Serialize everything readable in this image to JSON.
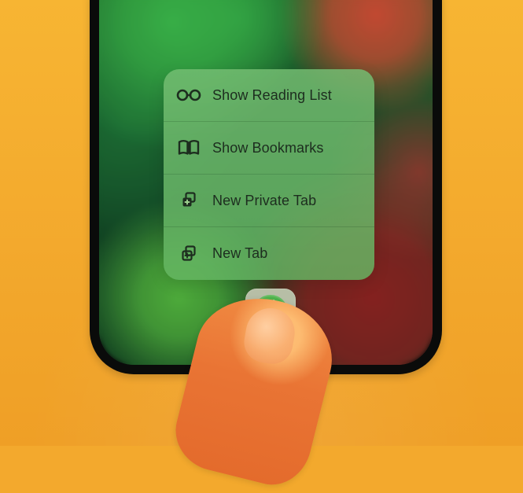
{
  "menu": {
    "items": [
      {
        "label": "Show Reading List",
        "icon": "glasses-icon"
      },
      {
        "label": "Show Bookmarks",
        "icon": "book-icon"
      },
      {
        "label": "New Private Tab",
        "icon": "private-tab-icon"
      },
      {
        "label": "New Tab",
        "icon": "new-tab-icon"
      }
    ]
  },
  "colors": {
    "background": "#f3a92d",
    "menu_tint": "#62b45f",
    "text": "#1d2d1f"
  }
}
